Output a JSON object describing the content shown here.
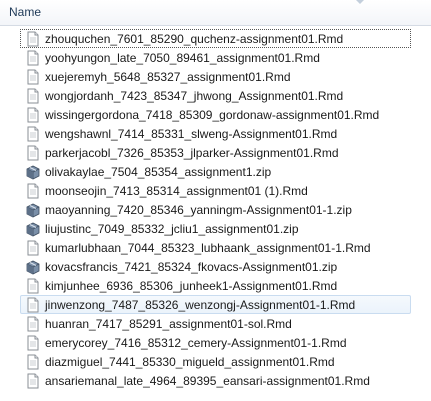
{
  "header": {
    "name_label": "Name"
  },
  "files": [
    {
      "name": "zhouquchen_7601_85290_quchenz-assignment01.Rmd",
      "icon": "document-icon"
    },
    {
      "name": "yoohyungon_late_7050_89461_assignment01.Rmd",
      "icon": "document-icon"
    },
    {
      "name": "xuejeremyh_5648_85327_assignment01.Rmd",
      "icon": "document-icon"
    },
    {
      "name": "wongjordanh_7423_85347_jhwong_Assignment01.Rmd",
      "icon": "document-icon"
    },
    {
      "name": "wissingergordona_7418_85309_gordonaw-assignment01.Rmd",
      "icon": "document-icon"
    },
    {
      "name": "wengshawnl_7414_85331_slweng-Assignment01.Rmd",
      "icon": "document-icon"
    },
    {
      "name": "parkerjacobl_7326_85353_jlparker-Assignment01.Rmd",
      "icon": "document-icon"
    },
    {
      "name": "olivakaylae_7504_85354_assignment1.zip",
      "icon": "zip-archive-icon"
    },
    {
      "name": "moonseojin_7413_85314_assignment01 (1).Rmd",
      "icon": "document-icon"
    },
    {
      "name": "maoyanning_7420_85346_yanningm-Assignment01-1.zip",
      "icon": "zip-archive-icon"
    },
    {
      "name": "liujustinc_7049_85332_jcliu1_assignment01.zip",
      "icon": "zip-archive-icon"
    },
    {
      "name": "kumarlubhaan_7044_85323_lubhaank_assignment01-1.Rmd",
      "icon": "document-icon"
    },
    {
      "name": "kovacsfrancis_7421_85324_fkovacs-Assignment01.zip",
      "icon": "zip-archive-icon"
    },
    {
      "name": "kimjunhee_6936_85306_junheek1-Assignment01.Rmd",
      "icon": "document-icon"
    },
    {
      "name": "jinwenzong_7487_85326_wenzongj-Assignment01-1.Rmd",
      "icon": "document-icon"
    },
    {
      "name": "huanran_7417_85291_assignment01-sol.Rmd",
      "icon": "document-icon"
    },
    {
      "name": "emerycorey_7416_85312_cemery-Assignment01-1.Rmd",
      "icon": "document-icon"
    },
    {
      "name": "diazmiguel_7441_85330_migueld_assignment01.Rmd",
      "icon": "document-icon"
    },
    {
      "name": "ansariemanal_late_4964_89395_eansari-assignment01.Rmd",
      "icon": "document-icon"
    }
  ],
  "focused_index": 0,
  "hovered_index": 14
}
